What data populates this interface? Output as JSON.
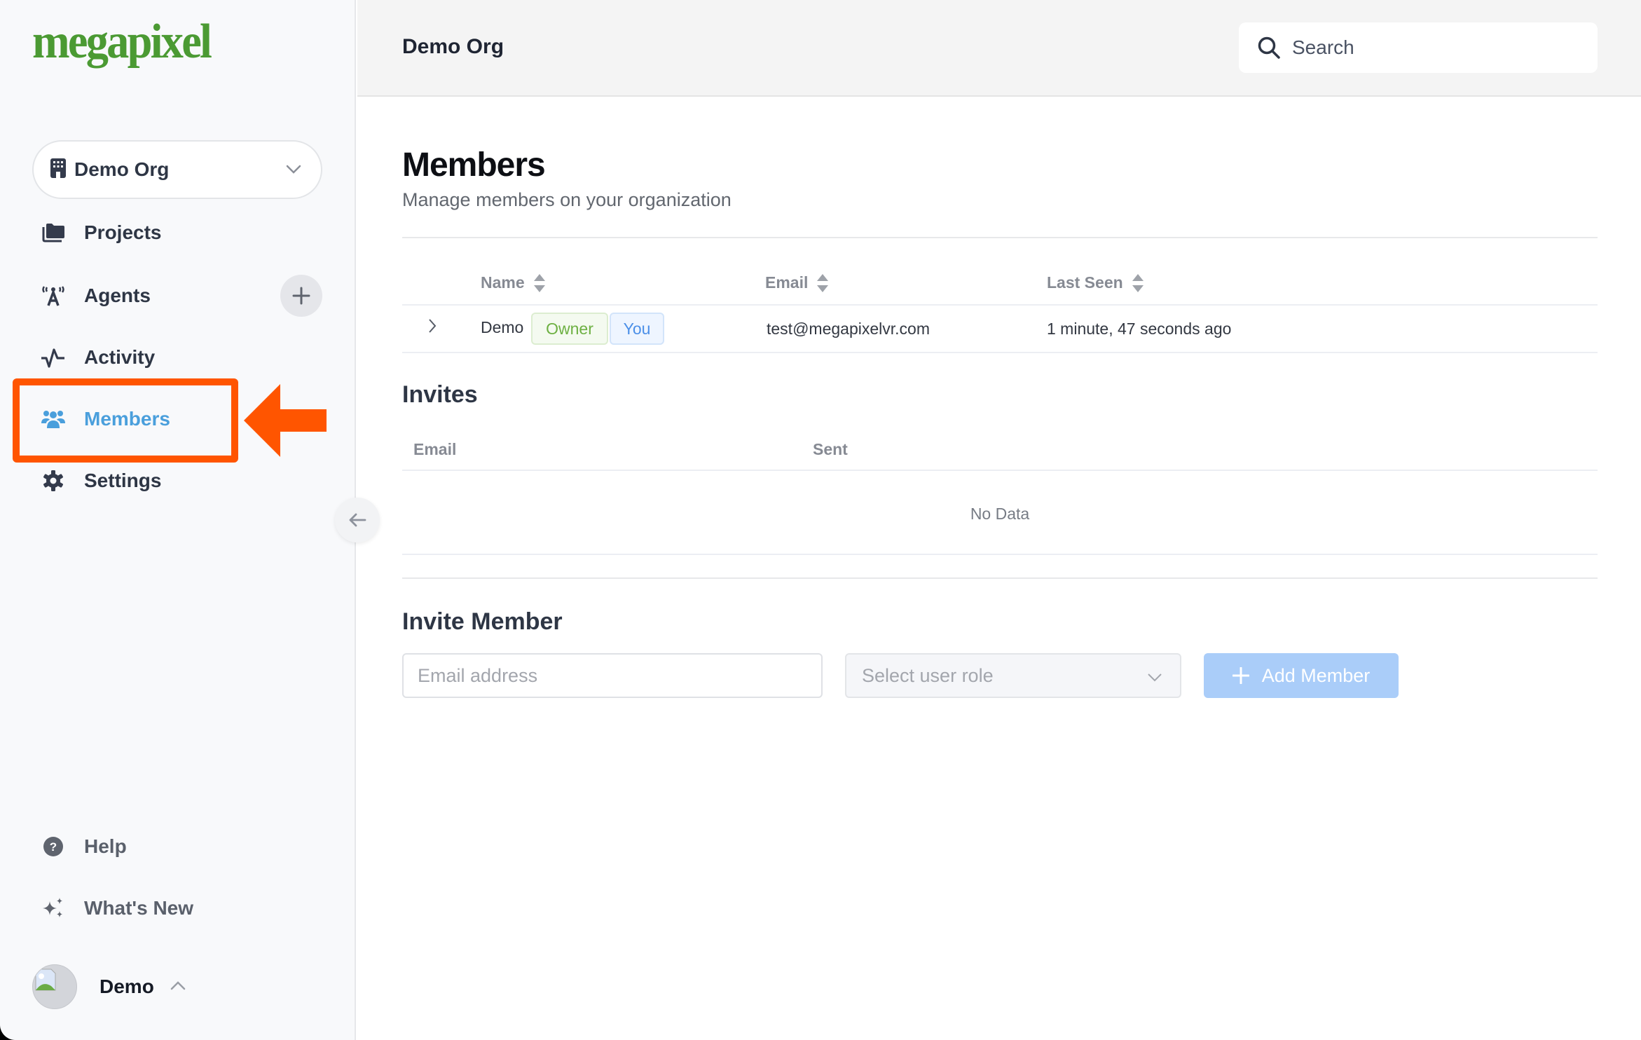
{
  "app": {
    "logo": "megapixel",
    "brand_color": "#4b9a33",
    "accent_color": "#4a9fdc",
    "highlight_color": "#ff5500"
  },
  "sidebar": {
    "org_selector": {
      "label": "Demo Org",
      "icon": "building-icon"
    },
    "items": [
      {
        "label": "Projects",
        "icon": "folder-icon",
        "active": false
      },
      {
        "label": "Agents",
        "icon": "antenna-icon",
        "active": false
      },
      {
        "label": "Activity",
        "icon": "activity-pulse-icon",
        "active": false
      },
      {
        "label": "Members",
        "icon": "users-icon",
        "active": true
      },
      {
        "label": "Settings",
        "icon": "gear-icon",
        "active": false
      }
    ],
    "footer_items": [
      {
        "label": "Help",
        "icon": "help-circle-icon"
      },
      {
        "label": "What's New",
        "icon": "sparkles-icon"
      }
    ],
    "user": {
      "name": "Demo"
    }
  },
  "topbar": {
    "title": "Demo Org",
    "search_placeholder": "Search"
  },
  "main": {
    "title": "Members",
    "subtitle": "Manage members on your organization",
    "members_table": {
      "columns": [
        "Name",
        "Email",
        "Last Seen"
      ],
      "rows": [
        {
          "name": "Demo",
          "tags": [
            "Owner",
            "You"
          ],
          "email": "test@megapixelvr.com",
          "last_seen": "1 minute, 47 seconds ago"
        }
      ]
    },
    "invites": {
      "title": "Invites",
      "columns": [
        "Email",
        "Sent"
      ],
      "empty_text": "No Data"
    },
    "invite_member": {
      "title": "Invite Member",
      "email_placeholder": "Email address",
      "role_placeholder": "Select user role",
      "add_label": "Add Member"
    }
  }
}
